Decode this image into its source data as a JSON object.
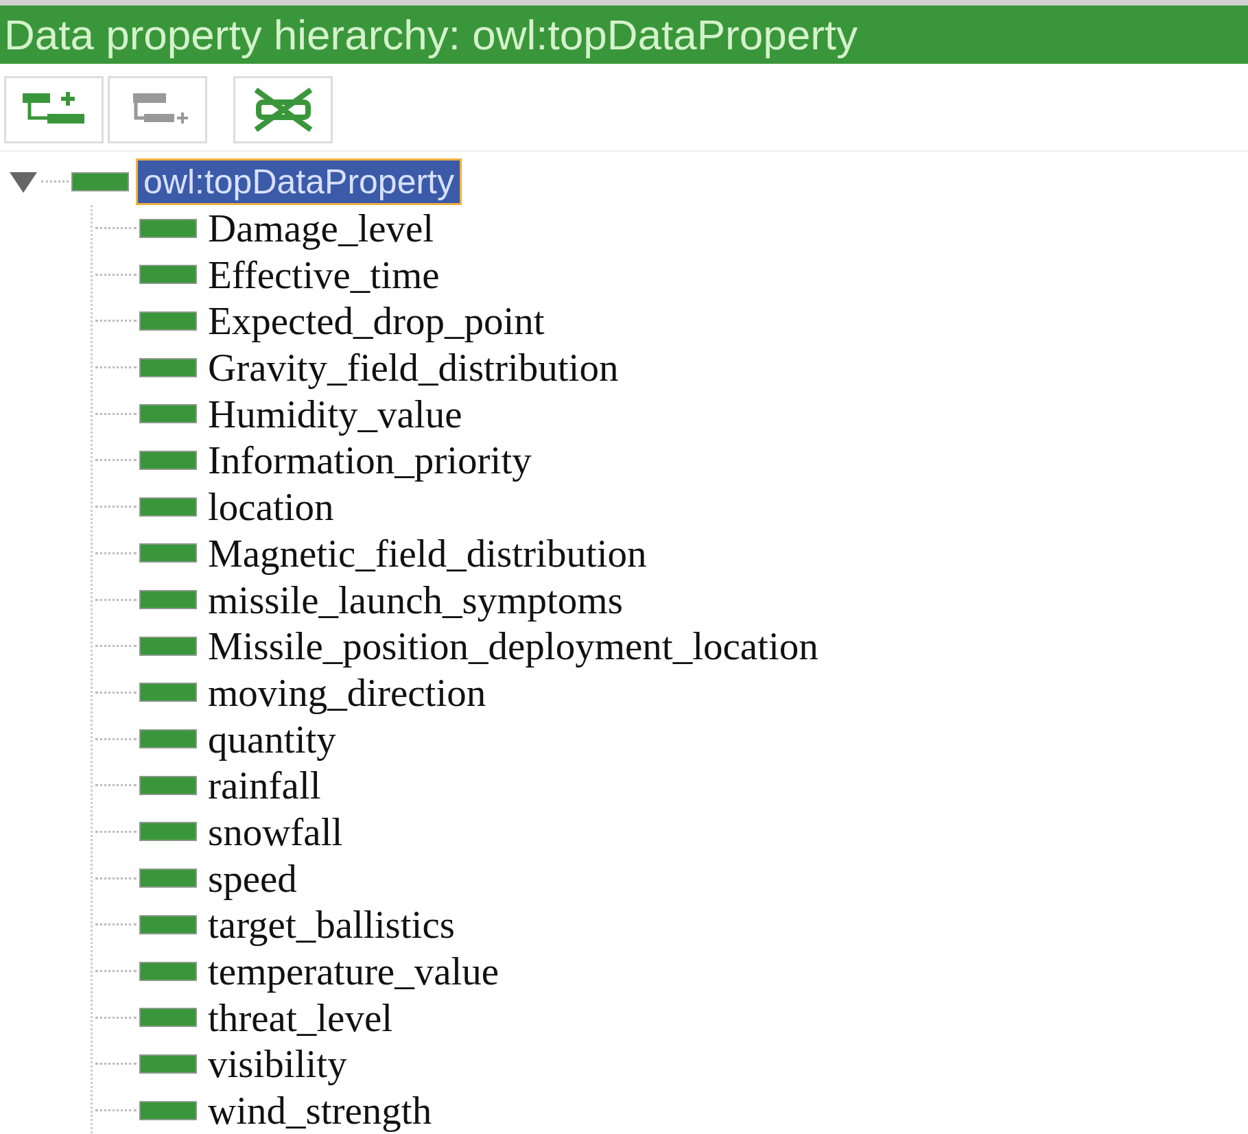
{
  "header": {
    "title": "Data property hierarchy: owl:topDataProperty"
  },
  "toolbar": {
    "buttons": [
      {
        "kind": "add-sub"
      },
      {
        "kind": "add-sibling"
      },
      {
        "kind": "delete"
      }
    ]
  },
  "tree": [
    {
      "label": "owl:topDataProperty",
      "selected": true,
      "expanded": true,
      "children": [
        {
          "label": "Damage_level",
          "selected": false
        },
        {
          "label": "Effective_time",
          "selected": false
        },
        {
          "label": "Expected_drop_point",
          "selected": false
        },
        {
          "label": "Gravity_field_distribution",
          "selected": false
        },
        {
          "label": "Humidity_value",
          "selected": false
        },
        {
          "label": "Information_priority",
          "selected": false
        },
        {
          "label": "location",
          "selected": false
        },
        {
          "label": "Magnetic_field_distribution",
          "selected": false
        },
        {
          "label": "missile_launch_symptoms",
          "selected": false
        },
        {
          "label": "Missile_position_deployment_location",
          "selected": false
        },
        {
          "label": "moving_direction",
          "selected": false
        },
        {
          "label": "quantity",
          "selected": false
        },
        {
          "label": "rainfall",
          "selected": false
        },
        {
          "label": "snowfall",
          "selected": false
        },
        {
          "label": "speed",
          "selected": false
        },
        {
          "label": "target_ballistics",
          "selected": false
        },
        {
          "label": "temperature_value",
          "selected": false
        },
        {
          "label": "threat_level",
          "selected": false
        },
        {
          "label": "visibility",
          "selected": false
        },
        {
          "label": "wind_strength",
          "selected": false
        }
      ]
    }
  ]
}
